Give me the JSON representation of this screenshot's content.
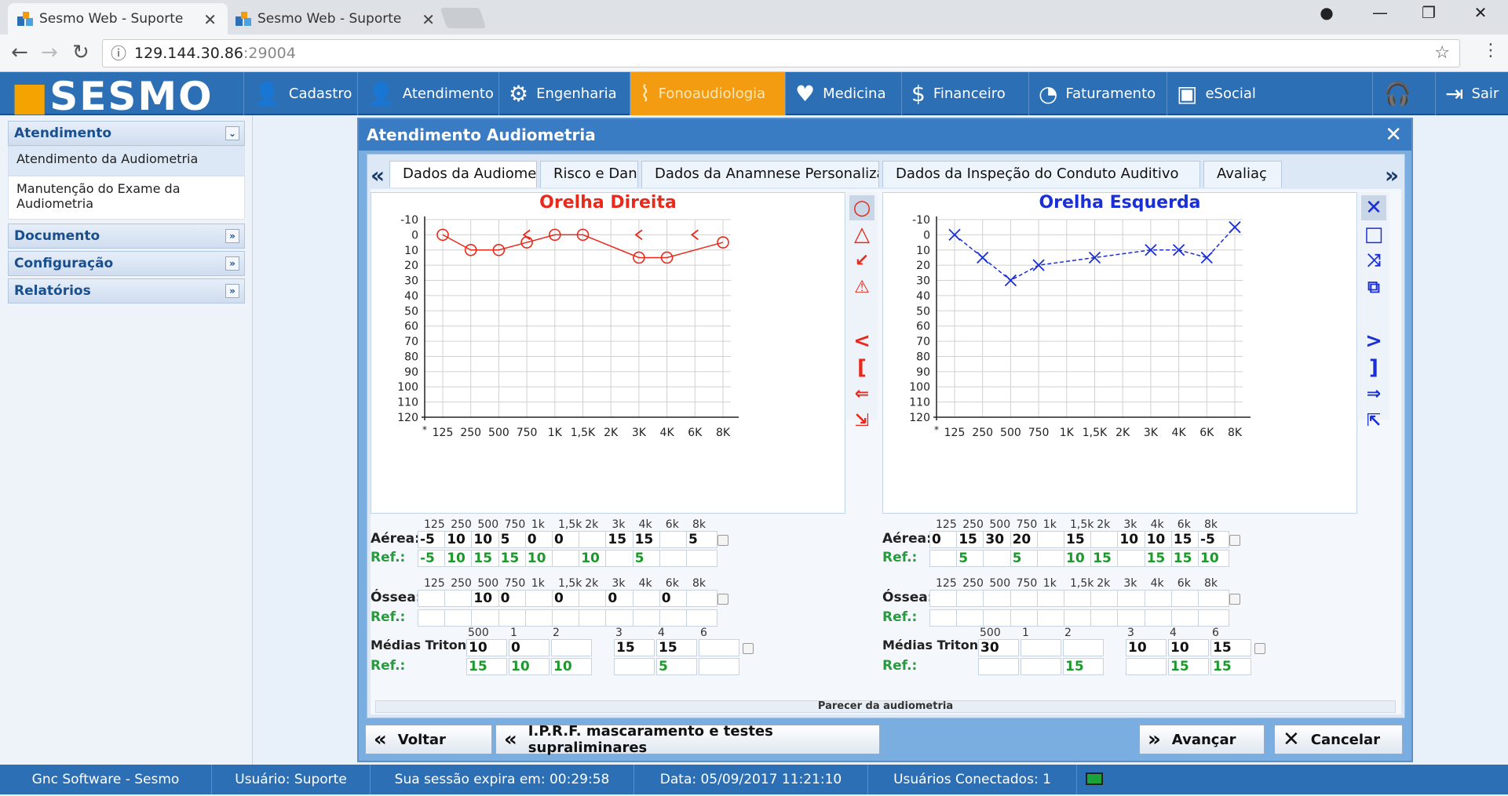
{
  "browser": {
    "tabs": [
      {
        "title": "Sesmo Web - Suporte"
      },
      {
        "title": "Sesmo Web - Suporte"
      }
    ],
    "url_host": "129.144.30.86",
    "url_port": ":29004"
  },
  "app": {
    "logo": "SESMO",
    "menu": [
      "Cadastro",
      "Atendimento",
      "Engenharia",
      "Fonoaudiologia",
      "Medicina",
      "Financeiro",
      "Faturamento",
      "eSocial",
      "Sair"
    ]
  },
  "sidebar": {
    "sections": [
      {
        "title": "Atendimento",
        "items": [
          "Atendimento da Audiometria",
          "Manutenção do Exame da Audiometria"
        ]
      },
      {
        "title": "Documento"
      },
      {
        "title": "Configuração"
      },
      {
        "title": "Relatórios"
      }
    ]
  },
  "dialog": {
    "title": "Atendimento Audiometria",
    "tabs": [
      "Dados da Audiometria",
      "Risco e Dano",
      "Dados da Anamnese Personalizada",
      "Dados da Inspeção do Conduto Auditivo",
      "Avaliaç"
    ],
    "parecer": "Parecer da audiometria",
    "buttons": {
      "back": "Voltar",
      "iprf": "I.P.R.F. mascaramento e testes supraliminares",
      "next": "Avançar",
      "cancel": "Cancelar"
    }
  },
  "freq_labels": [
    "125",
    "250",
    "500",
    "750",
    "1k",
    "1,5k",
    "2k",
    "3k",
    "4k",
    "6k",
    "8k"
  ],
  "tri_labels": [
    "500",
    "1",
    "2",
    "3",
    "4",
    "6"
  ],
  "row_labels": {
    "aerea": "Aérea:",
    "ref": "Ref.:",
    "ossea": "Óssea:",
    "tri": "Médias Tritonais:"
  },
  "right_ear": {
    "title": "Orelha Direita",
    "color": "#e8291c",
    "aerea": [
      "-5",
      "10",
      "10",
      "5",
      "0",
      "0",
      "",
      "15",
      "15",
      "",
      "5"
    ],
    "aerea_ref": [
      "-5",
      "10",
      "15",
      "15",
      "10",
      "",
      "10",
      "",
      "5",
      "",
      ""
    ],
    "ossea": [
      "",
      "",
      "10",
      "0",
      "",
      "0",
      "",
      "0",
      "",
      "0",
      ""
    ],
    "ossea_ref": [
      "",
      "",
      "",
      "",
      "",
      "",
      "",
      "",
      "",
      "",
      ""
    ],
    "tri": [
      "10",
      "0",
      "",
      "15",
      "15",
      ""
    ],
    "tri_ref": [
      "15",
      "10",
      "10",
      "",
      "5",
      ""
    ]
  },
  "left_ear": {
    "title": "Orelha Esquerda",
    "color": "#1a2fd6",
    "aerea": [
      "0",
      "15",
      "30",
      "20",
      "",
      "15",
      "",
      "10",
      "10",
      "15",
      "-5"
    ],
    "aerea_ref": [
      "",
      "5",
      "",
      "5",
      "",
      "10",
      "15",
      "",
      "15",
      "15",
      "10"
    ],
    "ossea": [
      "",
      "",
      "",
      "",
      "",
      "",
      "",
      "",
      "",
      "",
      ""
    ],
    "ossea_ref": [
      "",
      "",
      "",
      "",
      "",
      "",
      "",
      "",
      "",
      "",
      ""
    ],
    "tri": [
      "30",
      "",
      "",
      "10",
      "10",
      "15"
    ],
    "tri_ref": [
      "",
      "",
      "15",
      "",
      "15",
      "15"
    ]
  },
  "chart_data": [
    {
      "type": "line",
      "title": "Orelha Direita",
      "categories": [
        "125",
        "250",
        "500",
        "750",
        "1K",
        "1,5K",
        "2K",
        "3K",
        "4K",
        "6K",
        "8K"
      ],
      "y_ticks": [
        -10,
        0,
        10,
        20,
        30,
        40,
        50,
        60,
        70,
        80,
        90,
        100,
        110,
        120
      ],
      "ylim": [
        -10,
        120
      ],
      "y_inverted": true,
      "x_start_label": "*",
      "series": [
        {
          "marker": "circle",
          "values": [
            0,
            10,
            10,
            5,
            0,
            0,
            null,
            15,
            15,
            null,
            5
          ]
        },
        {
          "marker": "<",
          "values": [
            null,
            null,
            null,
            0,
            null,
            null,
            null,
            0,
            null,
            0,
            null
          ]
        }
      ]
    },
    {
      "type": "line",
      "title": "Orelha Esquerda",
      "categories": [
        "125",
        "250",
        "500",
        "750",
        "1K",
        "1,5K",
        "2K",
        "3K",
        "4K",
        "6K",
        "8K"
      ],
      "y_ticks": [
        -10,
        0,
        10,
        20,
        30,
        40,
        50,
        60,
        70,
        80,
        90,
        100,
        110,
        120
      ],
      "ylim": [
        -10,
        120
      ],
      "y_inverted": true,
      "x_start_label": "*",
      "series": [
        {
          "marker": "x",
          "line": "dashed",
          "values": [
            0,
            15,
            30,
            20,
            null,
            15,
            null,
            10,
            10,
            15,
            -5
          ]
        }
      ]
    }
  ],
  "status": {
    "company": "Gnc Software - Sesmo",
    "user": "Usuário: Suporte",
    "session": "Sua sessão expira em: 00:29:58",
    "date": "Data: 05/09/2017 11:21:10",
    "connected": "Usuários Conectados: 1"
  }
}
